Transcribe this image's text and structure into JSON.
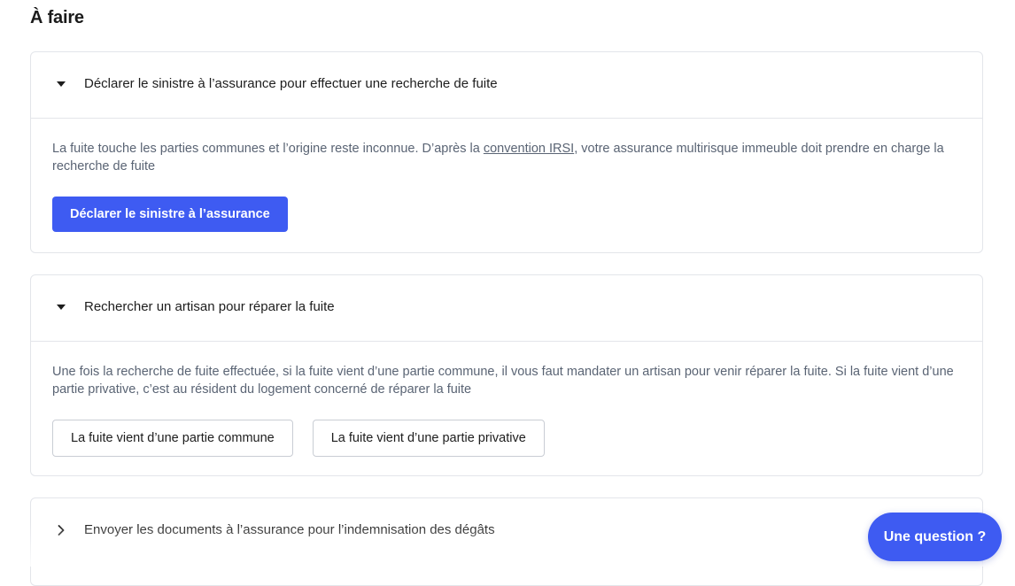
{
  "page": {
    "title": "À faire"
  },
  "tasks": [
    {
      "title": "Déclarer le sinistre à l’assurance pour effectuer une recherche de fuite",
      "expanded": true,
      "description_before": "La fuite touche les parties communes et l’origine reste inconnue. D’après la ",
      "description_link": "convention IRSI",
      "description_after": ", votre assurance multirisque immeuble doit prendre en charge la recherche de fuite",
      "primary_button": "Déclarer le sinistre à l’assurance"
    },
    {
      "title": "Rechercher un artisan pour réparer la fuite",
      "expanded": true,
      "description": "Une fois la recherche de fuite effectuée, si la fuite vient d’une partie commune, il vous faut mandater un artisan pour venir réparer la fuite. Si la fuite vient d’une partie privative, c’est au résident du logement concerné de réparer la fuite",
      "options": [
        "La fuite vient d’une partie commune",
        "La fuite vient d’une partie privative"
      ]
    },
    {
      "title": "Envoyer les documents à l’assurance pour l’indemnisation des dégâts",
      "expanded": false
    }
  ],
  "help_button": "Une question ?",
  "icons": {
    "expanded": "caret-down-icon",
    "collapsed": "chevron-right-icon"
  },
  "colors": {
    "primary": "#3e5bf2",
    "text": "#1d1d1d",
    "muted": "#5a6474",
    "border": "#e3e5ea"
  }
}
